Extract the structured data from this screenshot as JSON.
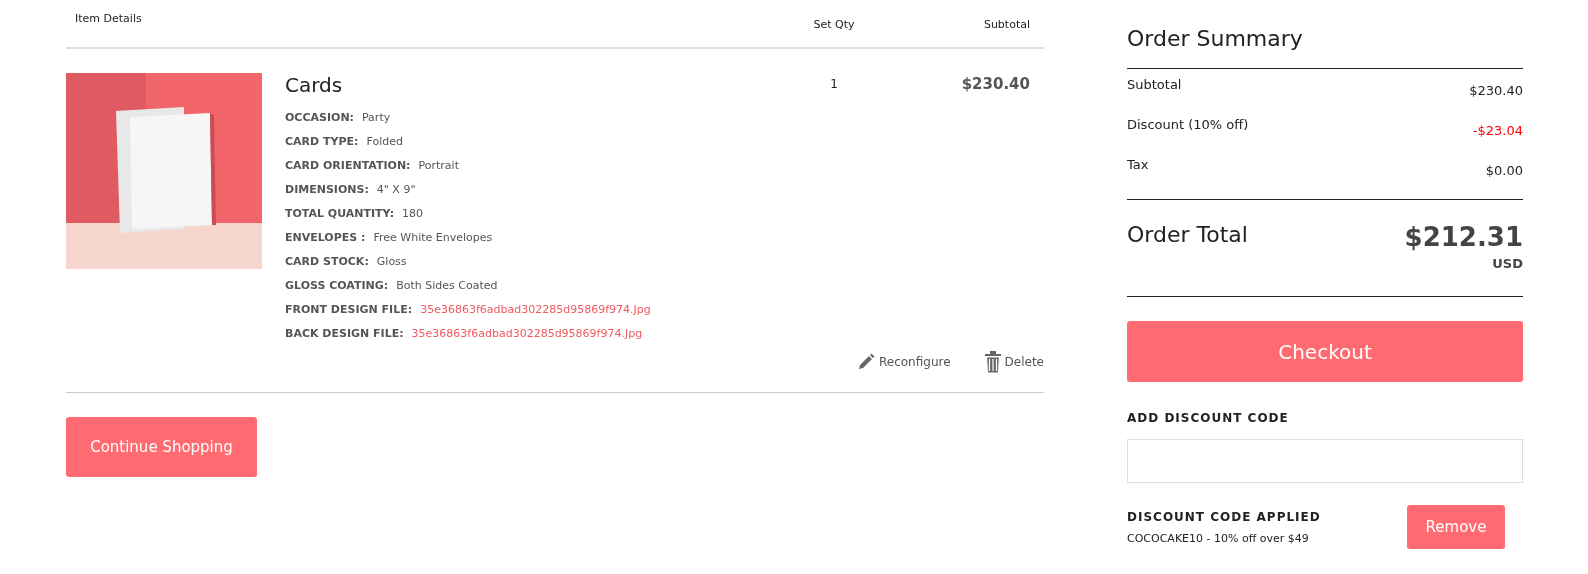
{
  "cart": {
    "columns": [
      "Item Details",
      "Set Qty",
      "Subtotal"
    ],
    "item": {
      "kind": "picture",
      "name": "Cards",
      "qty": "1",
      "subtotal": "$230.40",
      "options": [
        {
          "label": "OCCASION:",
          "value": "Party",
          "kind": "text"
        },
        {
          "label": "CARD TYPE:",
          "value": "Folded",
          "kind": "text"
        },
        {
          "label": "CARD ORIENTATION:",
          "value": "Portrait",
          "kind": "text"
        },
        {
          "label": "DIMENSIONS:",
          "value": "4\" X 9\"",
          "kind": "text"
        },
        {
          "label": "TOTAL QUANTITY:",
          "value": "180",
          "kind": "text"
        },
        {
          "label": "ENVELOPES :",
          "value": "Free White Envelopes",
          "kind": "text"
        },
        {
          "label": "CARD STOCK:",
          "value": "Gloss",
          "kind": "text"
        },
        {
          "label": "GLOSS COATING:",
          "value": "Both Sides Coated",
          "kind": "text"
        },
        {
          "label": "FRONT DESIGN FILE:",
          "value": "35e36863f6adbad302285d95869f974.Jpg",
          "kind": "link"
        },
        {
          "label": "BACK DESIGN FILE:",
          "value": "35e36863f6adbad302285d95869f974.Jpg",
          "kind": "link"
        }
      ],
      "actions": [
        {
          "label": "Reconfigure",
          "kind": "edit"
        },
        {
          "label": "Delete",
          "kind": "delete"
        }
      ]
    },
    "continue_button": "Continue Shopping"
  },
  "summary": {
    "title": "Order Summary",
    "rows": [
      {
        "label": "Subtotal",
        "value": "$230.40",
        "kind": "normal"
      },
      {
        "label": "Discount (10% off)",
        "value": "-$23.04",
        "kind": "discount"
      },
      {
        "label": "Tax",
        "value": "$0.00",
        "kind": "normal"
      }
    ],
    "total_label": "Order Total",
    "total": "$212.31",
    "currency": "USD",
    "checkout_button": "Checkout",
    "discount_heading": "ADD DISCOUNT CODE",
    "applied_heading": "DISCOUNT CODE APPLIED",
    "applied_code": "COCOCAKE10 - 10% off over $49",
    "remove_button": "Remove"
  }
}
